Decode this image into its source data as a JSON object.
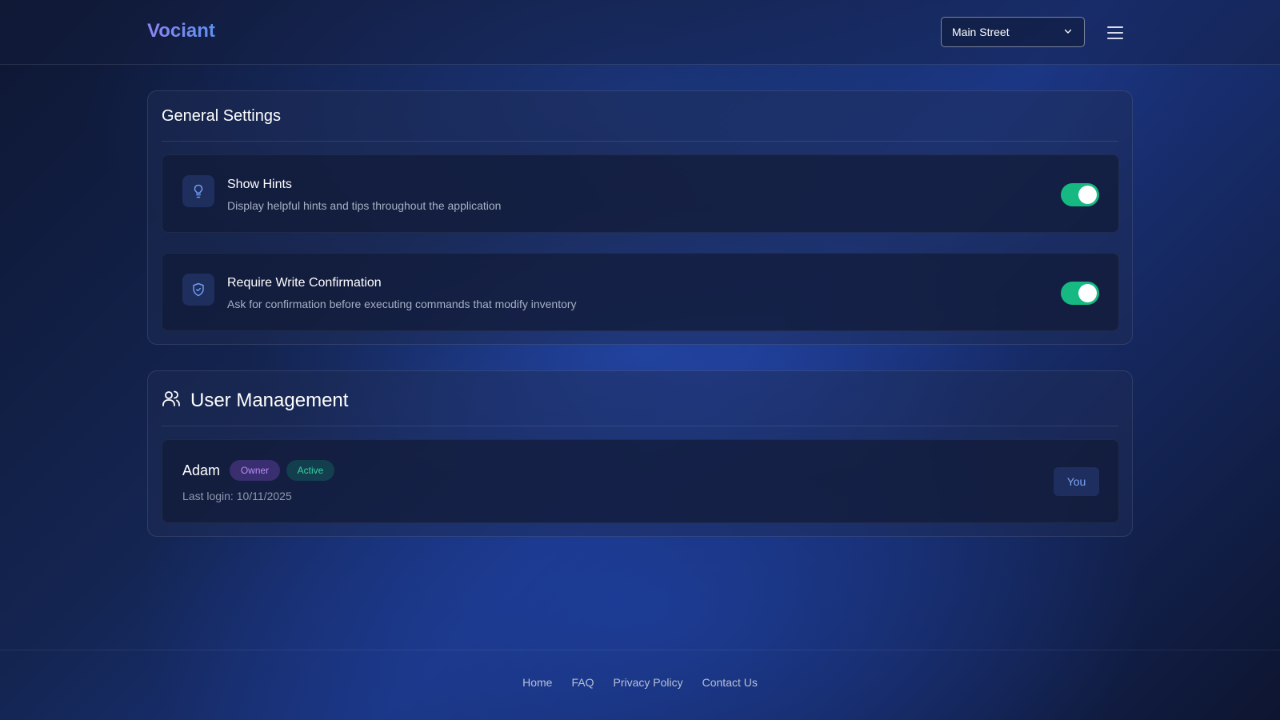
{
  "header": {
    "logo": "Vociant",
    "store_select": {
      "value": "Main Street"
    }
  },
  "general_settings": {
    "title": "General Settings",
    "settings": [
      {
        "icon": "lightbulb-icon",
        "title": "Show Hints",
        "description": "Display helpful hints and tips throughout the application",
        "enabled": true
      },
      {
        "icon": "shield-check-icon",
        "title": "Require Write Confirmation",
        "description": "Ask for confirmation before executing commands that modify inventory",
        "enabled": true
      }
    ]
  },
  "user_management": {
    "title": "User Management",
    "users": [
      {
        "name": "Adam",
        "role_badge": "Owner",
        "status_badge": "Active",
        "last_login": "Last login: 10/11/2025",
        "action_label": "You"
      }
    ]
  },
  "footer": {
    "links": [
      "Home",
      "FAQ",
      "Privacy Policy",
      "Contact Us"
    ]
  },
  "colors": {
    "accent_green": "#16b981",
    "logo_gradient_start": "#8b86f0",
    "logo_gradient_end": "#5d8ff0",
    "owner_badge": "#b98cf5",
    "active_badge": "#34d3a0",
    "you_button_text": "#7aa3f5"
  }
}
